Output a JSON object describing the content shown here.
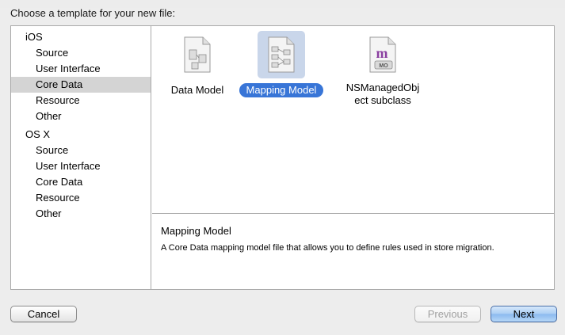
{
  "dialog": {
    "header": "Choose a template for your new file:"
  },
  "sidebar": {
    "sections": [
      {
        "title": "iOS",
        "items": [
          "Source",
          "User Interface",
          "Core Data",
          "Resource",
          "Other"
        ]
      },
      {
        "title": "OS X",
        "items": [
          "Source",
          "User Interface",
          "Core Data",
          "Resource",
          "Other"
        ]
      }
    ],
    "selected": "iOS / Core Data"
  },
  "templates": [
    {
      "label": "Data Model",
      "icon": "data-model-file-icon",
      "selected": false
    },
    {
      "label": "Mapping Model",
      "icon": "mapping-model-file-icon",
      "selected": true
    },
    {
      "label_line1": "NSManagedObj",
      "label_line2": "ect subclass",
      "icon": "managed-object-file-icon",
      "icon_letter": "m",
      "icon_badge": "MO",
      "selected": false
    }
  ],
  "description": {
    "title": "Mapping Model",
    "text": "A Core Data mapping model file that allows you to define rules used in store migration."
  },
  "buttons": {
    "cancel": "Cancel",
    "previous": "Previous",
    "next": "Next"
  },
  "colors": {
    "selection_blue": "#3875d7",
    "sidebar_selected": "#d4d4d4",
    "tile_selected_bg": "#c9d6ea"
  }
}
